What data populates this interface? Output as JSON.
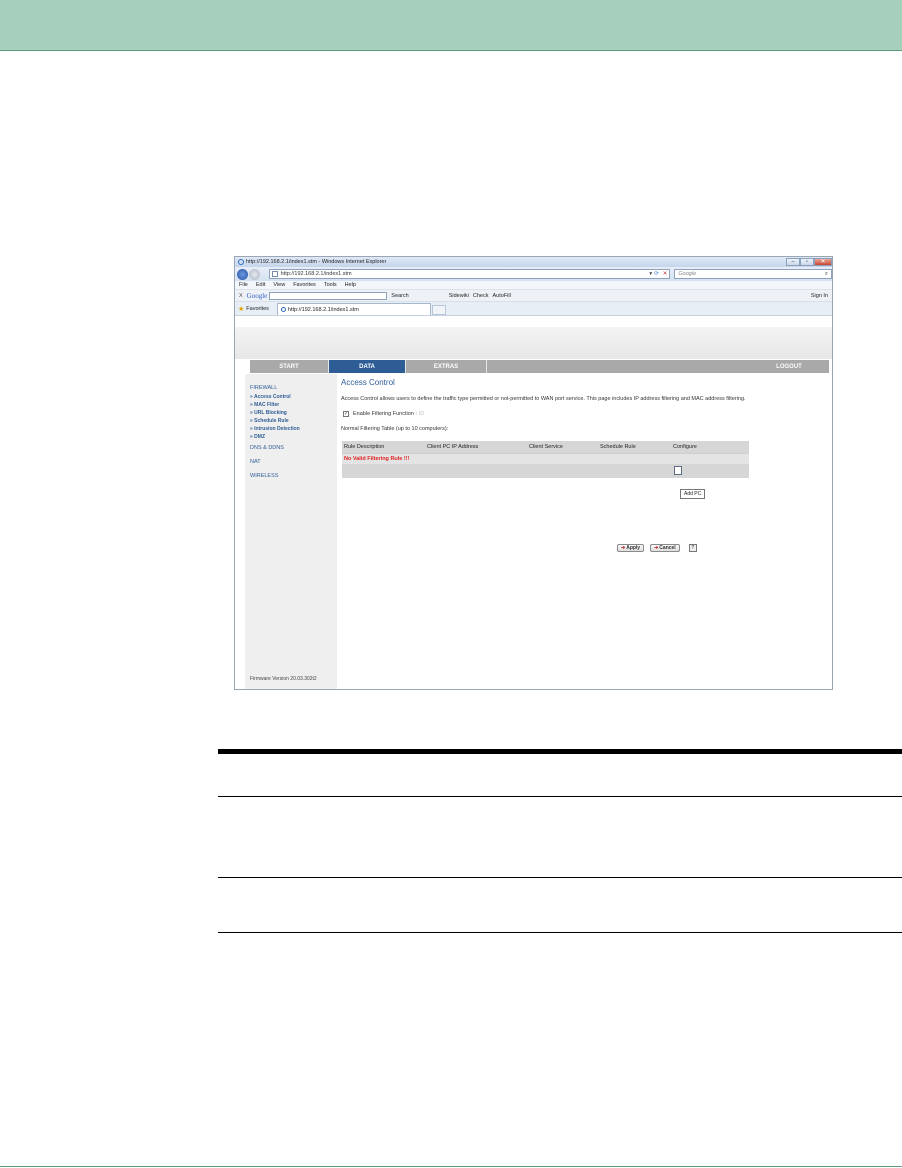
{
  "browser": {
    "window_title": "http://192.168.2.1/index1.stm - Windows Internet Explorer",
    "address": "http://192.168.2.1/index1.stm",
    "search_placeholder": "Google",
    "menu": [
      "File",
      "Edit",
      "View",
      "Favorites",
      "Tools",
      "Help"
    ],
    "google_toolbar": {
      "x_label": "X",
      "logo": "Google",
      "search_label": "Search",
      "sidewiki_label": "Sidewiki",
      "check_label": "Check",
      "autofill_label": "AutoFill",
      "sign_in_label": "Sign In"
    },
    "favorites_label": "Favorites",
    "tab_title": "http://192.168.2.1/index1.stm"
  },
  "router": {
    "nav": {
      "start": "START",
      "data": "DATA",
      "extras": "EXTRAS",
      "logout": "LOGOUT"
    },
    "sidebar": {
      "firewall": "FIREWALL",
      "items": [
        "» Access Control",
        "» MAC Filter",
        "» URL Blocking",
        "» Schedule Rule",
        "» Intrusion Detection",
        "» DMZ"
      ],
      "dns_ddns": "DNS & DDNS",
      "nat": "NAT",
      "wireless": "WIRELESS",
      "firmware": "Firmware Version 20.03.302t2"
    },
    "main": {
      "title": "Access Control",
      "description": "Access Control allows users to define the traffic type permitted or not-permitted to WAN port service. This page includes IP address filtering and MAC address filtering.",
      "enable_label": "Enable Filtering Function :",
      "enable_checked": true,
      "table_caption": "Normal Filtering Table (up to 10 computers):",
      "columns": [
        "Rule Description",
        "Client PC IP Address",
        "Client Service",
        "Schedule Rule",
        "Configure"
      ],
      "no_rule_text": "No Valid Filtering Rule !!!",
      "add_pc_tooltip": "Add PC",
      "apply_label": "Apply",
      "cancel_label": "Cancel",
      "help_label": "?"
    }
  }
}
